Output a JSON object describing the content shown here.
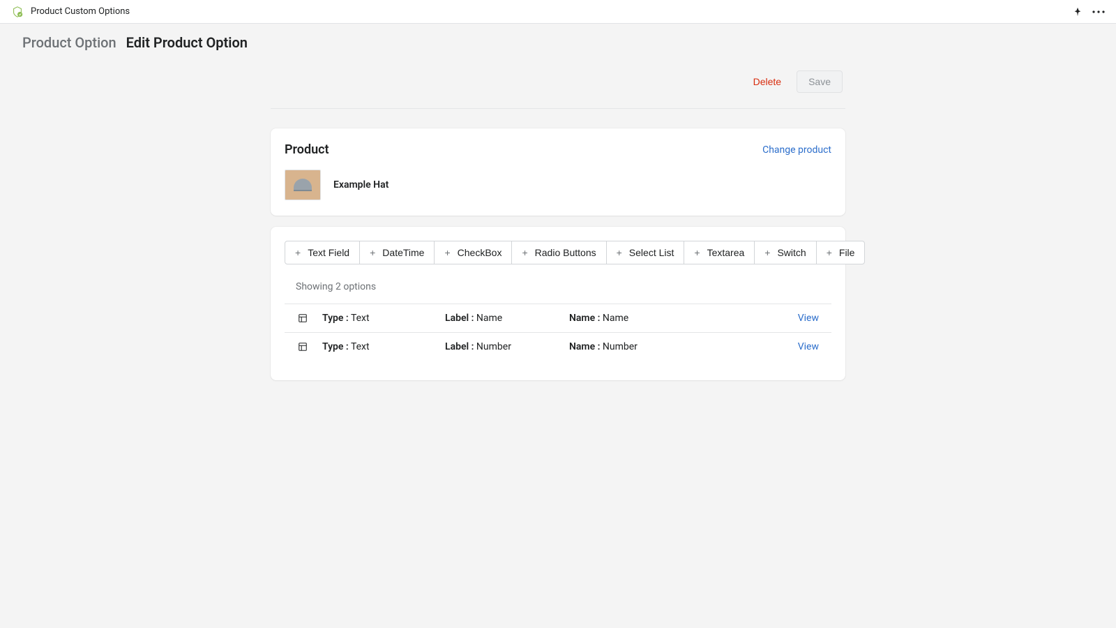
{
  "topbar": {
    "app_title": "Product Custom Options"
  },
  "breadcrumb": {
    "back": "Product Option",
    "current": "Edit Product Option"
  },
  "actions": {
    "delete": "Delete",
    "save": "Save"
  },
  "product_card": {
    "heading": "Product",
    "change_link": "Change product",
    "product_name": "Example Hat"
  },
  "option_types": [
    "Text Field",
    "DateTime",
    "CheckBox",
    "Radio Buttons",
    "Select List",
    "Textarea",
    "Switch",
    "File"
  ],
  "showing_text": "Showing 2 options",
  "labels": {
    "type": "Type :",
    "label": "Label :",
    "name": "Name :",
    "view": "View"
  },
  "options": [
    {
      "type": "Text",
      "label": "Name",
      "name": "Name"
    },
    {
      "type": "Text",
      "label": "Number",
      "name": "Number"
    }
  ]
}
